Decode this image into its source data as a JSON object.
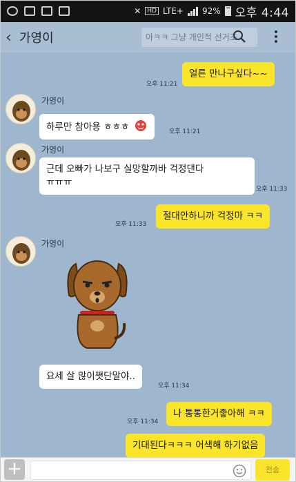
{
  "status_bar": {
    "network": "LTE+",
    "battery": "92%",
    "time": "오후 4:44"
  },
  "header": {
    "back_symbol": "‹",
    "title": "가영이",
    "notice": "아ㅋㅋ 그냥 개인적 선거조"
  },
  "messages": [
    {
      "side": "me",
      "text": "얼른 만나구싶다~~",
      "time": "오후 11:21"
    },
    {
      "side": "you",
      "sender": "가영이",
      "text": "하루만 참아용 ㅎㅎㅎ",
      "time": "오후 11:21"
    },
    {
      "side": "you",
      "sender": "가영이",
      "text_lines": [
        "근데 오빠가 나보구 실망할까바 걱정댄다",
        "ㅠㅠㅠ"
      ],
      "time": "오후 11:33"
    },
    {
      "side": "me",
      "text": "절대안하니까 걱정마 ㅋㅋ",
      "time": "오후 11:33"
    },
    {
      "side": "you",
      "sender": "가영이",
      "sticker": "brown-dog-sticker"
    },
    {
      "side": "you",
      "text": "요세 살 많이쪗단말야..",
      "time": "오후 11:34"
    },
    {
      "side": "me",
      "text": "나 통통한거좋아해 ㅋㅋ",
      "time": "오후 11:34"
    },
    {
      "side": "me",
      "text": "기대된다ㅋㅋㅋ 어색해 하기없음"
    }
  ],
  "input": {
    "send_label": "전송"
  },
  "colors": {
    "chat_bg": "#9fb6cf",
    "my_bubble": "#fbe52a",
    "their_bubble": "#ffffff"
  }
}
